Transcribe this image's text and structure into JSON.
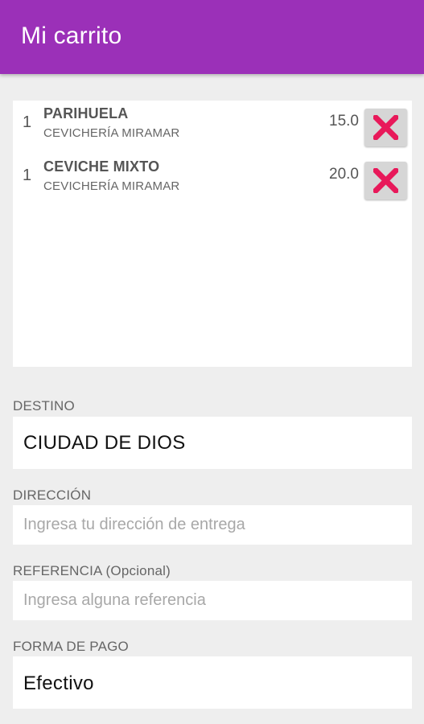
{
  "appbar": {
    "title": "Mi carrito",
    "color": "#9b30b8"
  },
  "cart": {
    "items": [
      {
        "qty": "1",
        "name": "PARIHUELA",
        "store": "CEVICHERÍA MIRAMAR",
        "price": "15.0",
        "remove_icon": "close-icon"
      },
      {
        "qty": "1",
        "name": "CEVICHE MIXTO",
        "store": "CEVICHERÍA MIRAMAR",
        "price": "20.0",
        "remove_icon": "close-icon"
      }
    ],
    "remove_icon_color": "#e8195a"
  },
  "form": {
    "destino": {
      "label": "DESTINO",
      "value": "CIUDAD DE DIOS"
    },
    "direccion": {
      "label": "DIRECCIÓN",
      "placeholder": "Ingresa tu dirección de entrega",
      "value": ""
    },
    "referencia": {
      "label": "REFERENCIA (Opcional)",
      "placeholder": "Ingresa alguna referencia",
      "value": ""
    },
    "pago": {
      "label": "FORMA DE PAGO",
      "value": "Efectivo"
    }
  }
}
